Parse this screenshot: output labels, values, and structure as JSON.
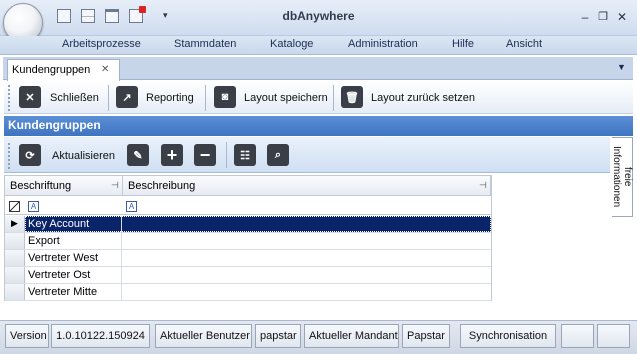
{
  "app": {
    "title": "dbAnywhere"
  },
  "window_controls": {
    "minimize": "–",
    "restore": "❐",
    "close": "✕"
  },
  "menu": [
    "Arbeitsprozesse",
    "Stammdaten",
    "Kataloge",
    "Administration",
    "Hilfe",
    "Ansicht"
  ],
  "tab": {
    "label": "Kundengruppen",
    "close": "✕"
  },
  "toolbar": {
    "close_label": "Schließen",
    "reporting_label": "Reporting",
    "save_layout_label": "Layout speichern",
    "reset_layout_label": "Layout zurück setzen"
  },
  "section": {
    "title": "Kundengruppen"
  },
  "grid_toolbar": {
    "refresh_label": "Aktualisieren"
  },
  "side_panel": {
    "label": "freie Informationen"
  },
  "grid": {
    "columns": [
      "Beschriftung",
      "Beschreibung"
    ],
    "rows": [
      {
        "beschriftung": "Key Account",
        "beschreibung": "",
        "selected": true
      },
      {
        "beschriftung": "Export",
        "beschreibung": ""
      },
      {
        "beschriftung": "Vertreter West",
        "beschreibung": ""
      },
      {
        "beschriftung": "Vertreter Ost",
        "beschreibung": ""
      },
      {
        "beschriftung": "Vertreter Mitte",
        "beschreibung": ""
      }
    ]
  },
  "statusbar": {
    "version_label": "Version",
    "version_value": "1.0.10122.150924",
    "user_label": "Aktueller Benutzer",
    "user_value": "papstar",
    "client_label": "Aktueller Mandant",
    "client_value": "Papstar",
    "sync_label": "Synchronisation"
  },
  "colors": {
    "accent": "#3f74c1",
    "selection": "#0a246a"
  }
}
